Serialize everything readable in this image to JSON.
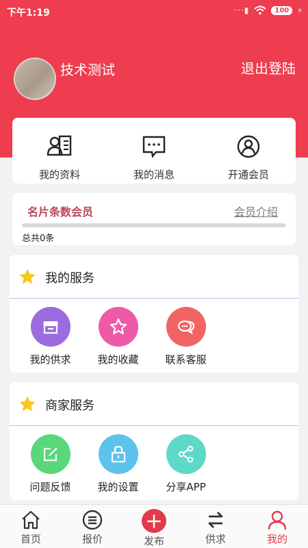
{
  "status_bar": {
    "time": "下午1:19",
    "battery": "100"
  },
  "profile": {
    "username": "技术测试",
    "logout_label": "退出登陆"
  },
  "quick_actions": [
    {
      "label": "我的资料",
      "icon": "profile-card-icon"
    },
    {
      "label": "我的消息",
      "icon": "message-icon"
    },
    {
      "label": "开通会员",
      "icon": "member-icon"
    }
  ],
  "membership": {
    "title": "名片条数会员",
    "intro_link": "会员介绍",
    "total": "总共0条",
    "progress": 0
  },
  "my_services": {
    "title": "我的服务",
    "items": [
      {
        "label": "我的供求",
        "icon": "shop-icon",
        "color": "#9b6bdf"
      },
      {
        "label": "我的收藏",
        "icon": "star-icon",
        "color": "#ee5aa8"
      },
      {
        "label": "联系客服",
        "icon": "chat-icon",
        "color": "#f26463"
      }
    ]
  },
  "merchant_services": {
    "title": "商家服务",
    "items": [
      {
        "label": "问题反馈",
        "icon": "feedback-icon",
        "color": "#5bd77b"
      },
      {
        "label": "我的设置",
        "icon": "lock-icon",
        "color": "#5ec3ec"
      },
      {
        "label": "分享APP",
        "icon": "share-icon",
        "color": "#5ed9c8"
      }
    ]
  },
  "tab_bar": [
    {
      "label": "首页",
      "icon": "home-icon"
    },
    {
      "label": "报价",
      "icon": "list-icon"
    },
    {
      "label": "发布",
      "icon": "plus-icon"
    },
    {
      "label": "供求",
      "icon": "swap-icon"
    },
    {
      "label": "我的",
      "icon": "user-icon",
      "active": true
    }
  ],
  "colors": {
    "brand": "#ee3d4e",
    "accent_text": "#b8465a",
    "star": "#f7c71e"
  }
}
